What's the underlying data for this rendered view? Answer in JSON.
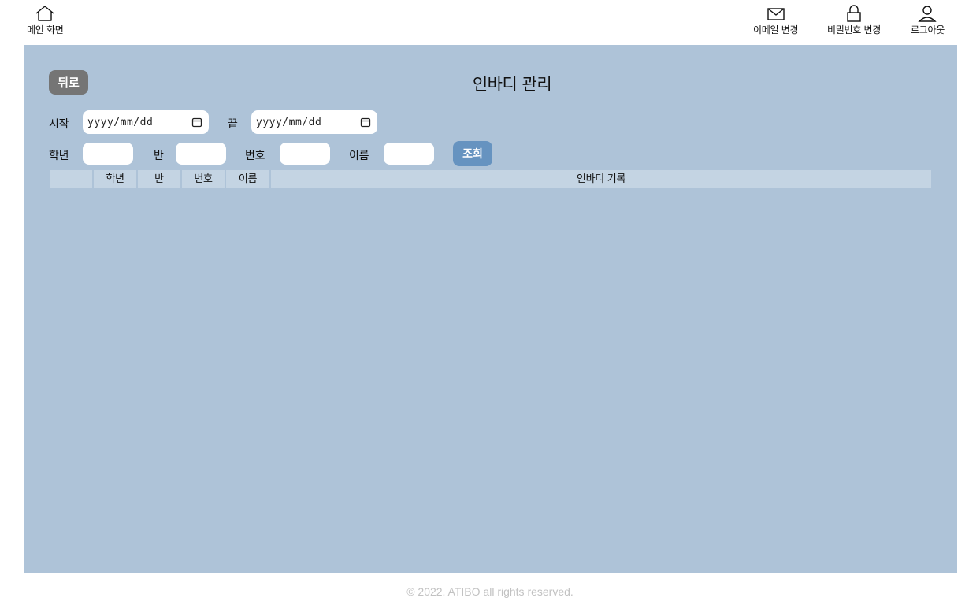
{
  "nav": {
    "home_label": "메인 화면",
    "email_label": "이메일 변경",
    "password_label": "비밀번호 변경",
    "logout_label": "로그아웃"
  },
  "page": {
    "title": "인바디 관리",
    "back_label": "뒤로"
  },
  "filters": {
    "start_label": "시작",
    "start_placeholder": "yyyy/mm/dd",
    "end_label": "끝",
    "end_placeholder": "yyyy/mm/dd",
    "grade_label": "학년",
    "class_label": "반",
    "number_label": "번호",
    "name_label": "이름",
    "search_label": "조회"
  },
  "table": {
    "columns": [
      "",
      "학년",
      "반",
      "번호",
      "이름",
      "인바디 기록"
    ]
  },
  "footer": {
    "copyright": "© 2022. ATIBO all rights reserved."
  },
  "colors": {
    "panel_bg": "#aec3d8",
    "search_button": "#6693c0",
    "back_button": "#757575",
    "table_header": "#c4d4e3"
  }
}
